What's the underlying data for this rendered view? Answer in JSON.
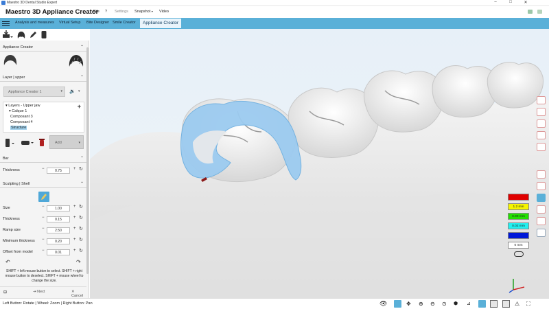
{
  "window": {
    "title": "Maestro 3D Dental Studio Expert",
    "controls": [
      "–",
      "□",
      "✕"
    ]
  },
  "menubar": {
    "brand": "Maestro 3D Appliance Creator",
    "items": [
      {
        "label": "File",
        "dim": false
      },
      {
        "label": "?",
        "dim": false
      },
      {
        "label": "Settings",
        "dim": true
      },
      {
        "label": "Snapshot",
        "dim": false,
        "caret": true
      },
      {
        "label": "Video",
        "dim": false
      }
    ]
  },
  "tabs": [
    {
      "label": "Analysis and measures",
      "active": false
    },
    {
      "label": "Virtual Setup",
      "active": false
    },
    {
      "label": "Bite Designer",
      "active": false
    },
    {
      "label": "Smile Creator",
      "active": false
    },
    {
      "label": "Appliance Creator",
      "active": true
    }
  ],
  "panel": {
    "appliance_creator": {
      "title": "Appliance Creator"
    },
    "layer": {
      "title": "Layer | upper",
      "select_value": "Appliance Creator 1",
      "tree_root": "Layers - Upper jaw",
      "tree_items": [
        "Calque 1",
        "Composant 3",
        "Composant 4",
        "Structure"
      ],
      "add_label": "Add"
    },
    "bar": {
      "title": "Bar",
      "thickness_label": "Thickness",
      "thickness_value": "0.75"
    },
    "sculpting": {
      "title": "Sculpting | Shell",
      "rows": [
        {
          "label": "Size",
          "value": "1.00"
        },
        {
          "label": "Thickness",
          "value": "0.15"
        },
        {
          "label": "Ramp size",
          "value": "2.50"
        },
        {
          "label": "Minimum thickness",
          "value": "0.20"
        },
        {
          "label": "Offset from model",
          "value": "0.01"
        }
      ],
      "help_text": "SHIFT + left mouse button to select. SHIFT + right mouse button to deselect. SHIFT + mouse wheel to change the size."
    },
    "footer": {
      "next_label": "Next",
      "cancel_label": "Cancel"
    }
  },
  "legend": {
    "items": [
      {
        "label": "",
        "color": "#e00000"
      },
      {
        "label": "1.2 mm",
        "color": "#f5f500"
      },
      {
        "label": "0.99 mm",
        "color": "#22e000"
      },
      {
        "label": "0.02 mm",
        "color": "#21f0f0"
      },
      {
        "label": "",
        "color": "#0018d8"
      }
    ],
    "zero_label": "0 mm"
  },
  "status": {
    "text": "Left Button: Rotate | Wheel: Zoom | Right Button: Pan"
  },
  "colors": {
    "accent": "#5ab0d8",
    "appliance": "#9ccbf0"
  }
}
